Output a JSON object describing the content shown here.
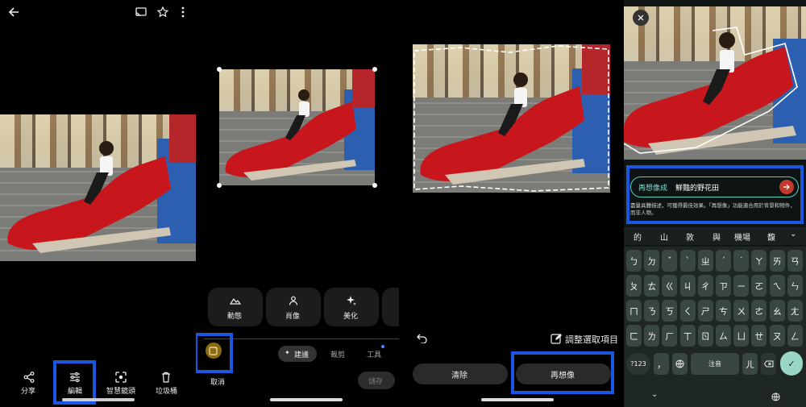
{
  "panel1": {
    "action_share": "分享",
    "action_edit": "編輯",
    "action_smart_lens": "智慧鏡頭",
    "action_trash": "垃圾桶"
  },
  "panel2": {
    "tools": [
      "動態",
      "肖像",
      "美化"
    ],
    "cancel_label": "取消",
    "tab_suggest": "建議",
    "tab_crop": "裁剪",
    "tab_tools": "工具",
    "save_label": "儲存"
  },
  "panel3": {
    "adjust_selection": "調整選取項目",
    "clear_button": "清除",
    "reimagine_button": "再想像"
  },
  "panel4": {
    "prompt_prefix": "再想像成",
    "prompt_value": "鮮豔的野花田",
    "hint_text": "盡量具體描述，可獲得最佳效果。「再想像」功能適合用於背景和物件，而非人物。",
    "suggestions": [
      "的",
      "山",
      "敦",
      "與",
      "機場",
      "馥"
    ],
    "key_rows": [
      [
        "ㄅ",
        "ㄉ",
        "ˇ",
        "ˋ",
        "ㄓ",
        "ˊ",
        "˙",
        "ㄚ",
        "ㄞ",
        "ㄢ"
      ],
      [
        "ㄆ",
        "ㄊ",
        "ㄍ",
        "ㄐ",
        "ㄔ",
        "ㄗ",
        "ㄧ",
        "ㄛ",
        "ㄟ",
        "ㄣ"
      ],
      [
        "ㄇ",
        "ㄋ",
        "ㄎ",
        "ㄑ",
        "ㄕ",
        "ㄘ",
        "ㄨ",
        "ㄜ",
        "ㄠ",
        "ㄤ"
      ],
      [
        "ㄈ",
        "ㄌ",
        "ㄏ",
        "ㄒ",
        "ㄖ",
        "ㄙ",
        "ㄩ",
        "ㄝ",
        "ㄡ",
        "ㄥ"
      ]
    ],
    "key_symbols": "?123",
    "key_space": "注音",
    "key_er": "ㄦ"
  }
}
